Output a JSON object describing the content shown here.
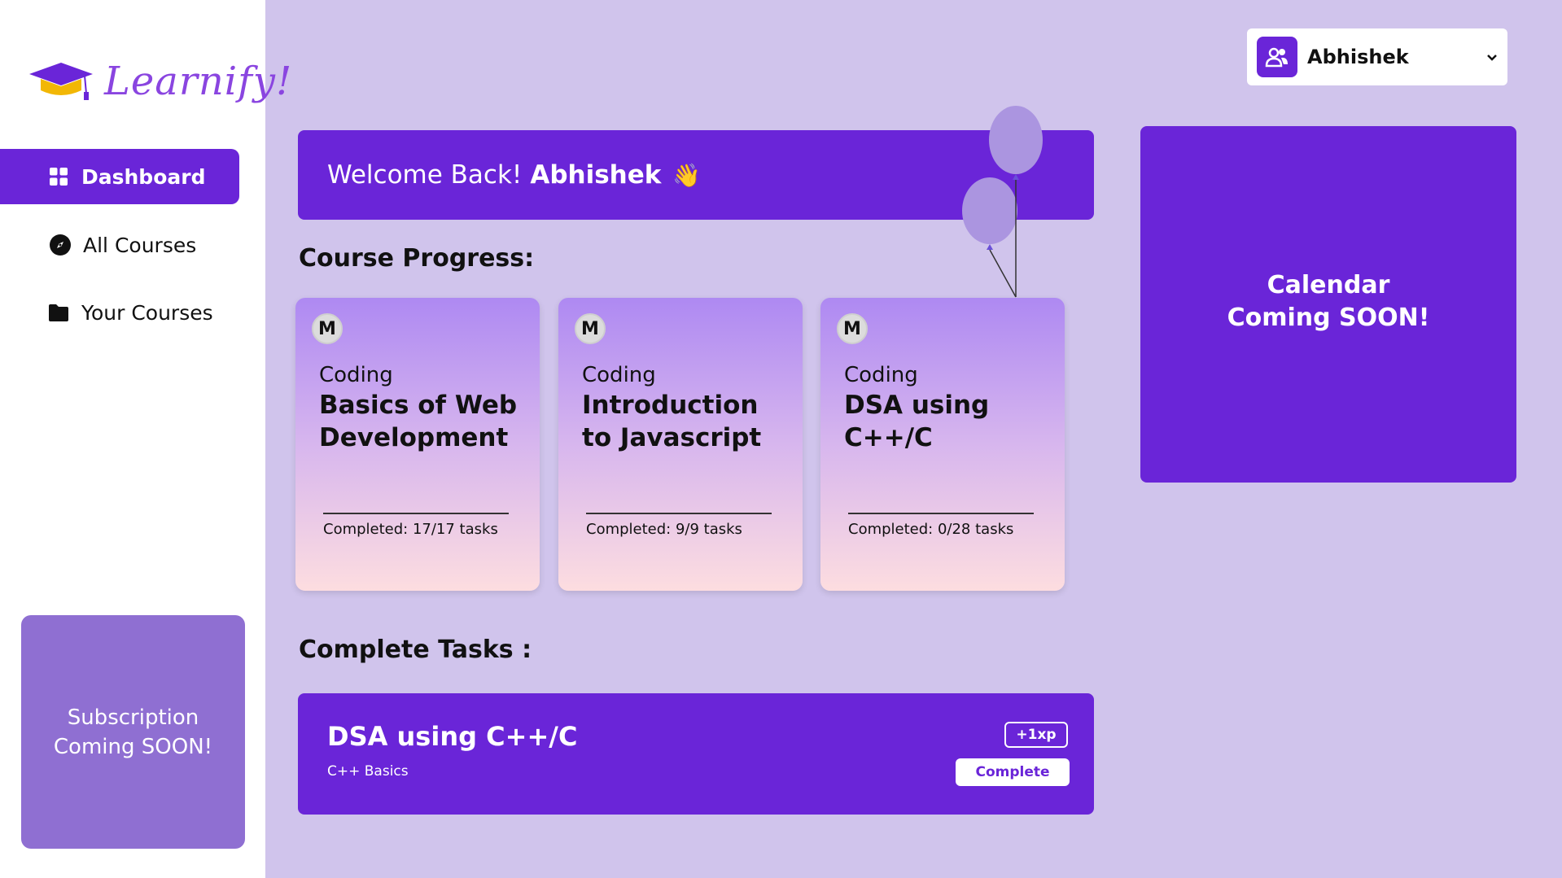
{
  "app": {
    "name": "Learnify!"
  },
  "sidebar": {
    "items": [
      {
        "label": "Dashboard",
        "icon": "grid-icon",
        "active": true
      },
      {
        "label": "All Courses",
        "icon": "compass-icon",
        "active": false
      },
      {
        "label": "Your Courses",
        "icon": "folder-icon",
        "active": false
      }
    ],
    "subscription": {
      "line1": "Subscription",
      "line2": "Coming SOON!"
    }
  },
  "user": {
    "name": "Abhishek"
  },
  "welcome": {
    "greeting": "Welcome Back!",
    "name": "Abhishek",
    "emoji": "👋"
  },
  "sections": {
    "progress_title": "Course Progress:",
    "tasks_title": "Complete Tasks :"
  },
  "courses": [
    {
      "badge": "M",
      "category": "Coding",
      "title": "Basics of Web Development",
      "completed_text": "Completed: 17/17 tasks"
    },
    {
      "badge": "M",
      "category": "Coding",
      "title": "Introduction to Javascript",
      "completed_text": "Completed: 9/9 tasks"
    },
    {
      "badge": "M",
      "category": "Coding",
      "title": "DSA using C++/C",
      "completed_text": "Completed: 0/28 tasks"
    }
  ],
  "task": {
    "title": "DSA using C++/C",
    "subtitle": "C++ Basics",
    "xp": "+1xp",
    "button": "Complete"
  },
  "calendar": {
    "line1": "Calendar",
    "line2": "Coming SOON!"
  },
  "colors": {
    "accent": "#6a25d8",
    "background": "#d0c4ec",
    "subscription": "#8f6fd2"
  }
}
